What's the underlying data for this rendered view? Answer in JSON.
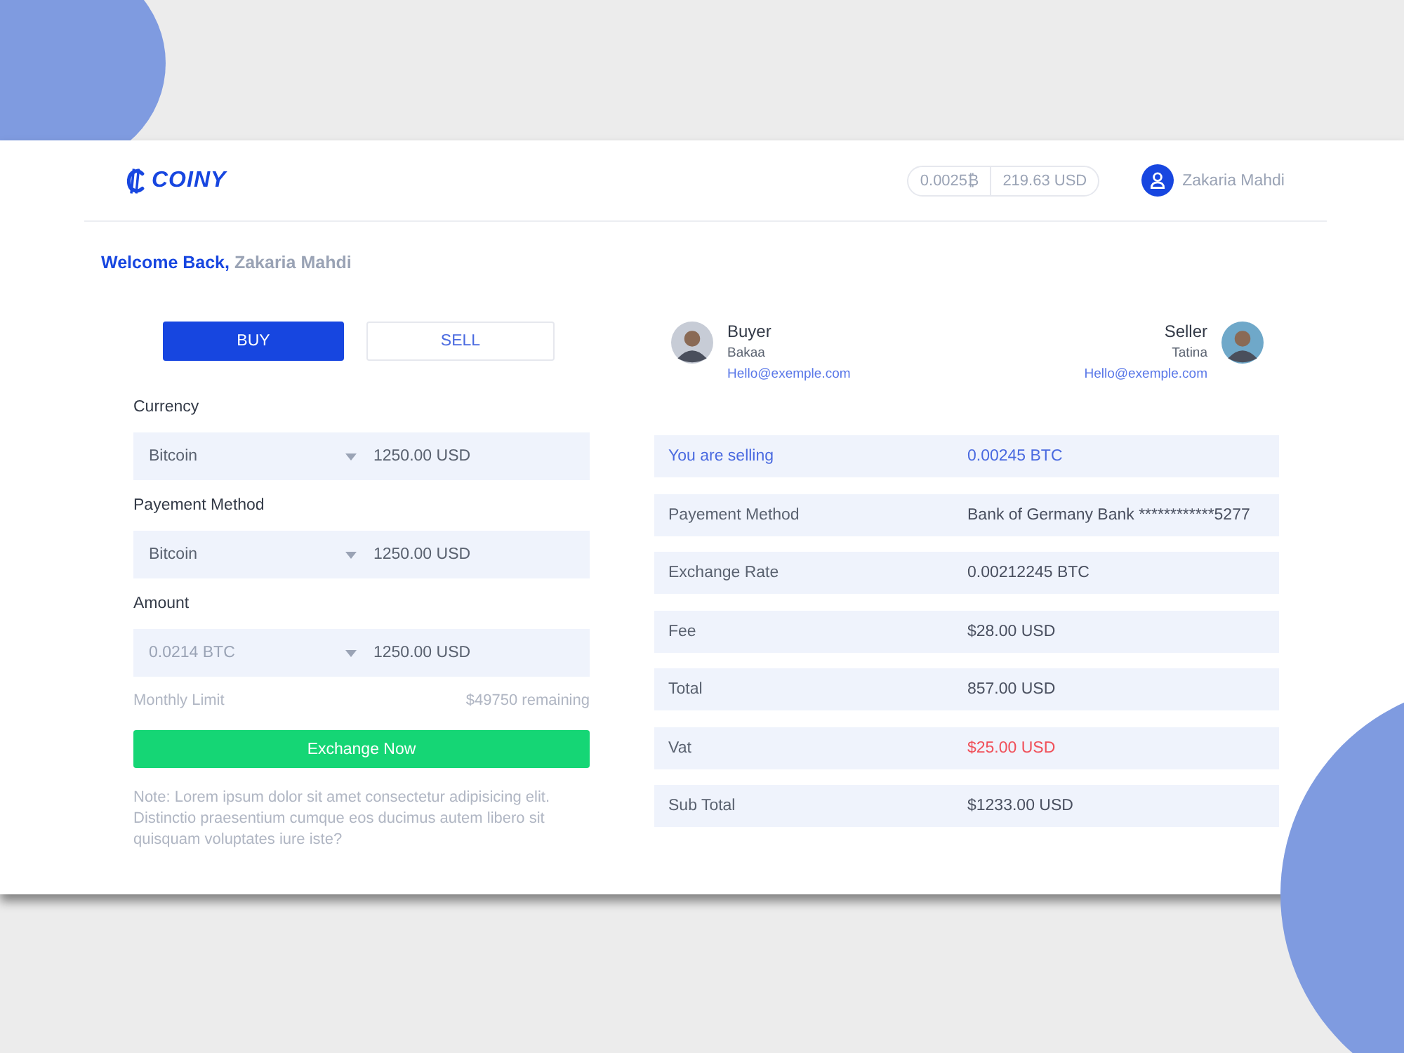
{
  "logo": {
    "text": "COINY"
  },
  "balance": {
    "btc": "0.0025₿",
    "usd": "219.63 USD"
  },
  "user": {
    "name": "Zakaria Mahdi"
  },
  "welcome": {
    "greeting": "Welcome Back,",
    "name": "Zakaria Mahdi"
  },
  "tabs": [
    {
      "label": "BUY",
      "selected": true
    },
    {
      "label": "SELL",
      "selected": false
    }
  ],
  "fields": [
    {
      "label": "Currency",
      "option": "Bitcoin",
      "amount": "1250.00 USD",
      "muted": false
    },
    {
      "label": "Payement Method",
      "option": "Bitcoin",
      "amount": "1250.00 USD",
      "muted": false
    },
    {
      "label": "Amount",
      "option": "0.0214 BTC",
      "amount": "1250.00 USD",
      "muted": true
    }
  ],
  "limit": {
    "label": "Monthly Limit",
    "remaining": "$49750 remaining"
  },
  "exchange_button": "Exchange Now",
  "note": "Note: Lorem ipsum dolor sit amet consectetur adipisicing elit. Distinctio praesentium cumque eos ducimus autem libero sit quisquam voluptates iure iste?",
  "parties": [
    {
      "kind": "start",
      "role": "Buyer",
      "name": "Bakaa",
      "email": "Hello@exemple.com"
    },
    {
      "kind": "end",
      "role": "Seller",
      "name": "Tatina",
      "email": "Hello@exemple.com"
    }
  ],
  "summary": [
    {
      "label": "You are selling",
      "value": "0.00245 BTC",
      "kind": "highlight"
    },
    {
      "label": "Payement Method",
      "value": "Bank of Germany Bank ************5277",
      "kind": "normal"
    },
    {
      "label": "Exchange Rate",
      "value": "0.00212245 BTC",
      "kind": "normal"
    },
    {
      "label": "Fee",
      "value": "$28.00 USD",
      "kind": "normal"
    },
    {
      "label": "Total",
      "value": "857.00 USD",
      "kind": "normal"
    },
    {
      "label": "Vat",
      "value": "$25.00 USD",
      "kind": "negative"
    },
    {
      "label": "Sub Total",
      "value": "$1233.00 USD",
      "kind": "normal"
    }
  ]
}
